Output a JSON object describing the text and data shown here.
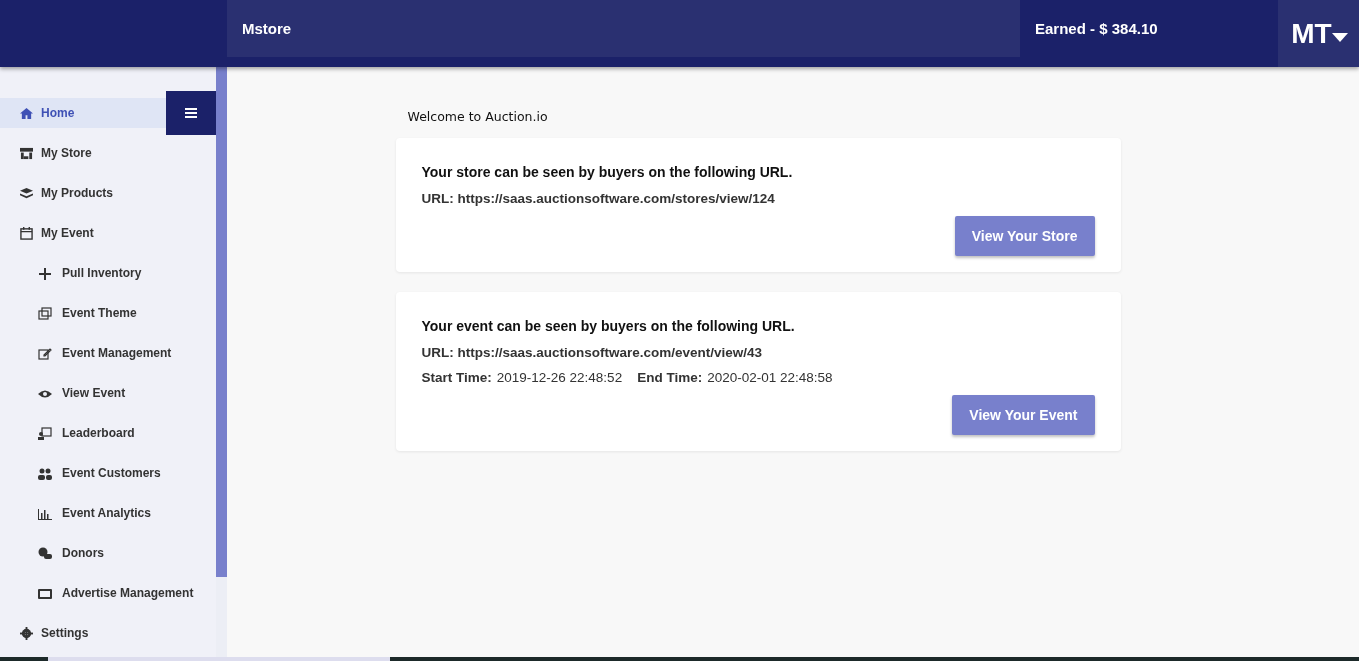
{
  "header": {
    "store_name": "Mstore",
    "earned": "Earned - $ 384.10",
    "user_initials": "MT"
  },
  "sidebar": {
    "items": [
      {
        "label": "Home",
        "selected": true
      },
      {
        "label": "My Store",
        "selected": false
      },
      {
        "label": "My Products",
        "selected": false
      },
      {
        "label": "My Event",
        "selected": false,
        "children": [
          {
            "label": "Pull Inventory",
            "selected": false
          },
          {
            "label": "Event Theme",
            "selected": false
          },
          {
            "label": "Event Management",
            "selected": false
          },
          {
            "label": "View Event",
            "selected": false
          },
          {
            "label": "Leaderboard",
            "selected": false
          },
          {
            "label": "Event Customers",
            "selected": false
          },
          {
            "label": "Event Analytics",
            "selected": false
          },
          {
            "label": "Donors",
            "selected": false
          },
          {
            "label": "Advertise Management",
            "selected": false
          }
        ]
      },
      {
        "label": "Settings",
        "selected": false
      }
    ]
  },
  "welcome": "Welcome to Auction.io",
  "cards": [
    {
      "heading": "Your store can be seen by buyers on the following URL.",
      "url": "URL: https://saas.auctionsoftware.com/stores/view/124",
      "button": "View Your Store"
    },
    {
      "heading": "Your event can be seen by buyers on the following URL.",
      "url": "URL: https://saas.auctionsoftware.com/event/view/43",
      "start_label": "Start Time:",
      "start_value": "2019-12-26 22:48:52",
      "end_label": "End Time:",
      "end_value": "2020-02-01 22:48:58",
      "button": "View Your Event"
    }
  ]
}
